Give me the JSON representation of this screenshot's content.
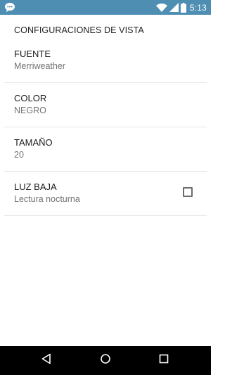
{
  "status_bar": {
    "time": "5:13",
    "background": "#4e8eb3",
    "icons": [
      "notification-icon",
      "wifi-icon",
      "cell-signal-icon",
      "battery-icon"
    ]
  },
  "settings": {
    "section_title": "CONFIGURACIONES DE VISTA",
    "items": [
      {
        "title": "FUENTE",
        "summary": "Merriweather"
      },
      {
        "title": "COLOR",
        "summary": "NEGRO"
      },
      {
        "title": "TAMAÑO",
        "summary": "20"
      },
      {
        "title": "LUZ BAJA",
        "summary": "Lectura nocturna",
        "checked": false
      }
    ]
  },
  "nav_bar": {
    "buttons": [
      "back-icon",
      "home-icon",
      "recents-icon"
    ]
  }
}
